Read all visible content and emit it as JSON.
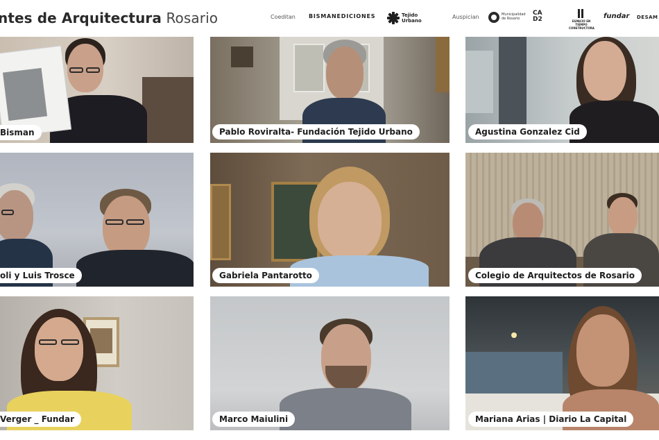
{
  "header": {
    "title_bold": "ntes de Arquitectura",
    "title_light": "Rosario",
    "coeditan_label": "Coeditan",
    "auspician_label": "Auspician",
    "logos": {
      "bisman": "BISMANEDICIONES",
      "tejido_line1": "Tejido",
      "tejido_line2": "Urbano",
      "muni_text": "Municipalidad de Rosario",
      "cad2_line1": "CA",
      "cad2_line2": "D2",
      "espacio": "ESPACIO EN TIEMPO CONSTRUCTORA",
      "fundar": "fundar",
      "desam": "DESAM"
    }
  },
  "participants": [
    {
      "name": "Bisman"
    },
    {
      "name": "Pablo Roviralta- Fundación Tejido Urbano"
    },
    {
      "name": "Agustina Gonzalez Cid"
    },
    {
      "name": "oli y Luis Trosce"
    },
    {
      "name": "Gabriela Pantarotto"
    },
    {
      "name": "Colegio de Arquitectos de Rosario"
    },
    {
      "name": "Verger _ Fundar"
    },
    {
      "name": "Marco Maiulini"
    },
    {
      "name": "Mariana Arias | Diario La Capital"
    }
  ],
  "colors": {
    "background": "#ffffff",
    "label_bg": "#ffffff",
    "label_text": "#1e1e1e"
  }
}
